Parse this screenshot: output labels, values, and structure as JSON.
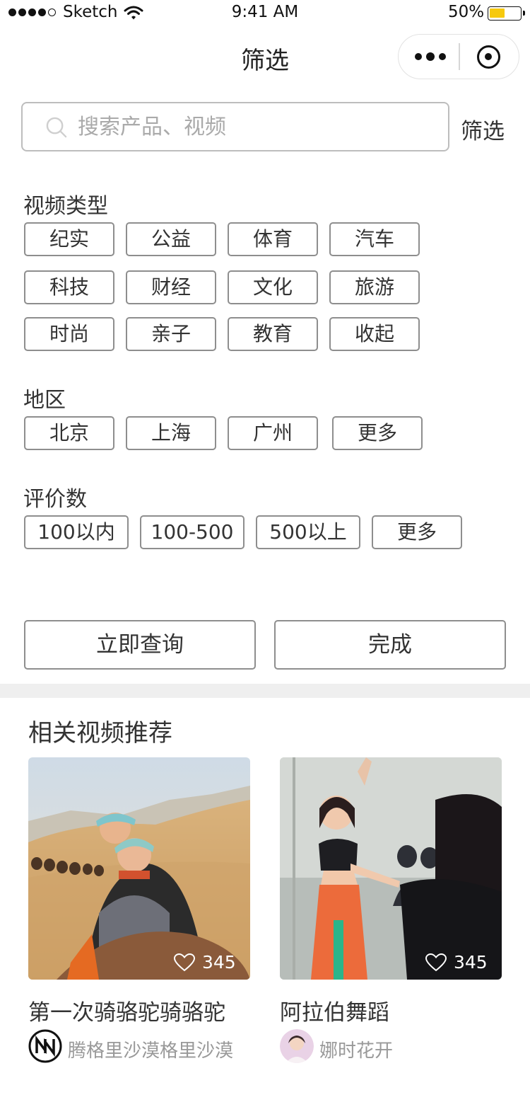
{
  "status_bar": {
    "carrier": "Sketch",
    "time": "9:41 AM",
    "battery": "50%",
    "battery_level": 0.5,
    "battery_color": "#f6c90e"
  },
  "nav": {
    "title": "筛选",
    "more_icon": "more-dots-icon",
    "close_icon": "target-icon"
  },
  "search": {
    "placeholder": "搜索产品、视频",
    "filter_label": "筛选"
  },
  "video_type": {
    "title": "视频类型",
    "tags": [
      "纪实",
      "公益",
      "体育",
      "汽车",
      "科技",
      "财经",
      "文化",
      "旅游",
      "时尚",
      "亲子",
      "教育",
      "收起"
    ]
  },
  "region": {
    "title": "地区",
    "tags": [
      "北京",
      "上海",
      "广州",
      "更多"
    ]
  },
  "rating": {
    "title": "评价数",
    "tags": [
      "100以内",
      "100-500",
      "500以上",
      "更多"
    ]
  },
  "actions": {
    "query": "立即查询",
    "done": "完成"
  },
  "recommend": {
    "title": "相关视频推荐",
    "cards": [
      {
        "title": "第一次骑骆驼骑骆驼",
        "likes": "345",
        "author": "腾格里沙漠格里沙漠"
      },
      {
        "title": "阿拉伯舞蹈",
        "likes": "345",
        "author": "娜时花开"
      }
    ]
  }
}
